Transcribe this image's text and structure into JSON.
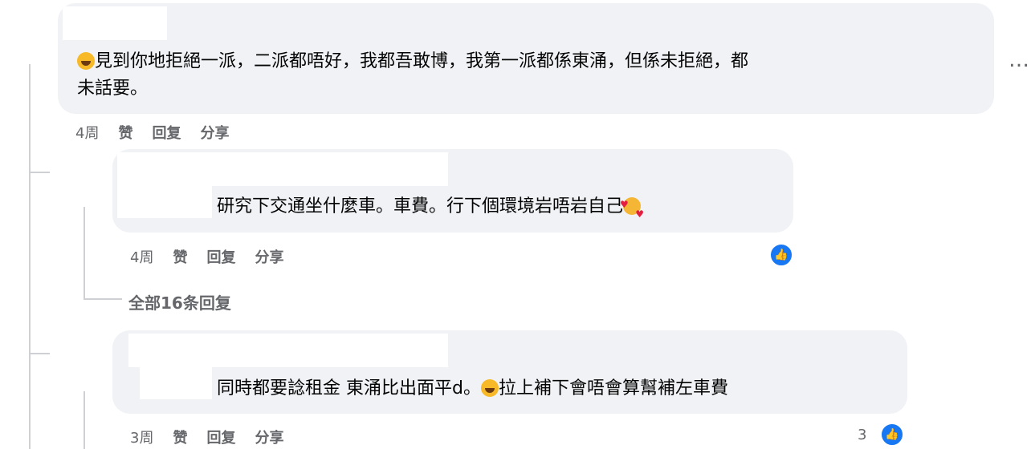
{
  "comments": [
    {
      "text_line1": "見到你地拒絕一派，二派都唔好，我都吾敢博，我第一派都係東涌，但係未拒絕，都",
      "text_line2": "未話要。",
      "time": "4周",
      "actions": {
        "like": "赞",
        "reply": "回复",
        "share": "分享"
      },
      "more": "…"
    }
  ],
  "replies": [
    {
      "text": "研究下交通坐什麼車。車費。行下個環境岩唔岩自己",
      "time": "4周",
      "actions": {
        "like": "赞",
        "reply": "回复",
        "share": "分享"
      }
    },
    {
      "text_before_emoji": "同時都要諗租金 東涌比出面平d。",
      "text_after_emoji": "拉上補下會唔會算幫補左車費",
      "time": "3周",
      "actions": {
        "like": "赞",
        "reply": "回复",
        "share": "分享"
      },
      "reaction_count": "3"
    }
  ],
  "view_all_replies": "全部16条回复",
  "colors": {
    "bubble": "#f0f2f5",
    "meta": "#65676b",
    "like_blue": "#1877f2"
  }
}
